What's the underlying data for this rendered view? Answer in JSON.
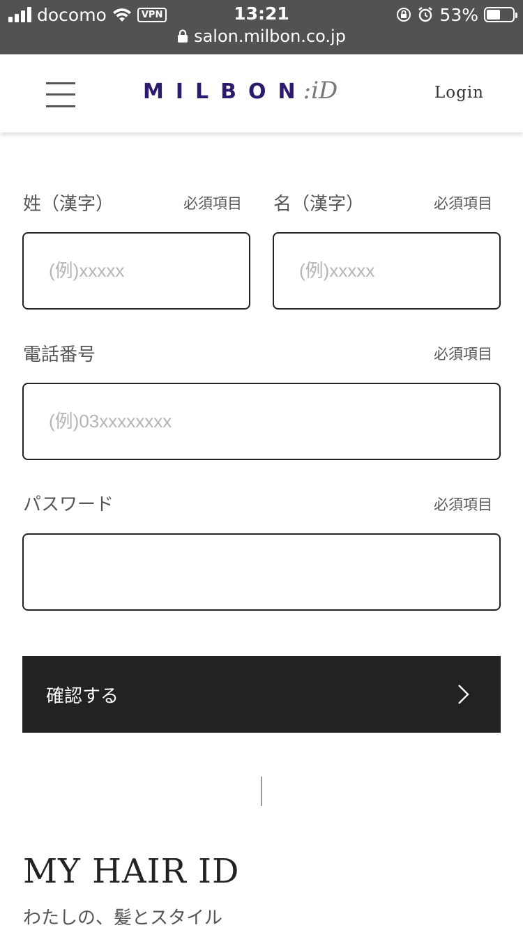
{
  "status_bar": {
    "carrier": "docomo",
    "vpn": "VPN",
    "time": "13:21",
    "battery": "53%",
    "battery_level": 0.53,
    "url": "salon.milbon.co.jp"
  },
  "header": {
    "logo_main": "MILBON",
    "logo_sub": ":iD",
    "login": "Login"
  },
  "form": {
    "last_name": {
      "label": "姓（漢字）",
      "required": "必須項目",
      "placeholder": "(例)xxxxx",
      "value": ""
    },
    "first_name": {
      "label": "名（漢字）",
      "required": "必須項目",
      "placeholder": "(例)xxxxx",
      "value": ""
    },
    "phone": {
      "label": "電話番号",
      "required": "必須項目",
      "placeholder": "(例)03xxxxxxxx",
      "value": ""
    },
    "password": {
      "label": "パスワード",
      "required": "必須項目",
      "placeholder": "",
      "value": ""
    },
    "confirm_label": "確認する"
  },
  "brand": {
    "title": "MY HAIR ID",
    "subtitle": "わたしの、髪とスタイル"
  },
  "colors": {
    "status_bar_bg": "#525252",
    "logo": "#2b1a6e",
    "button_bg": "#222222"
  }
}
